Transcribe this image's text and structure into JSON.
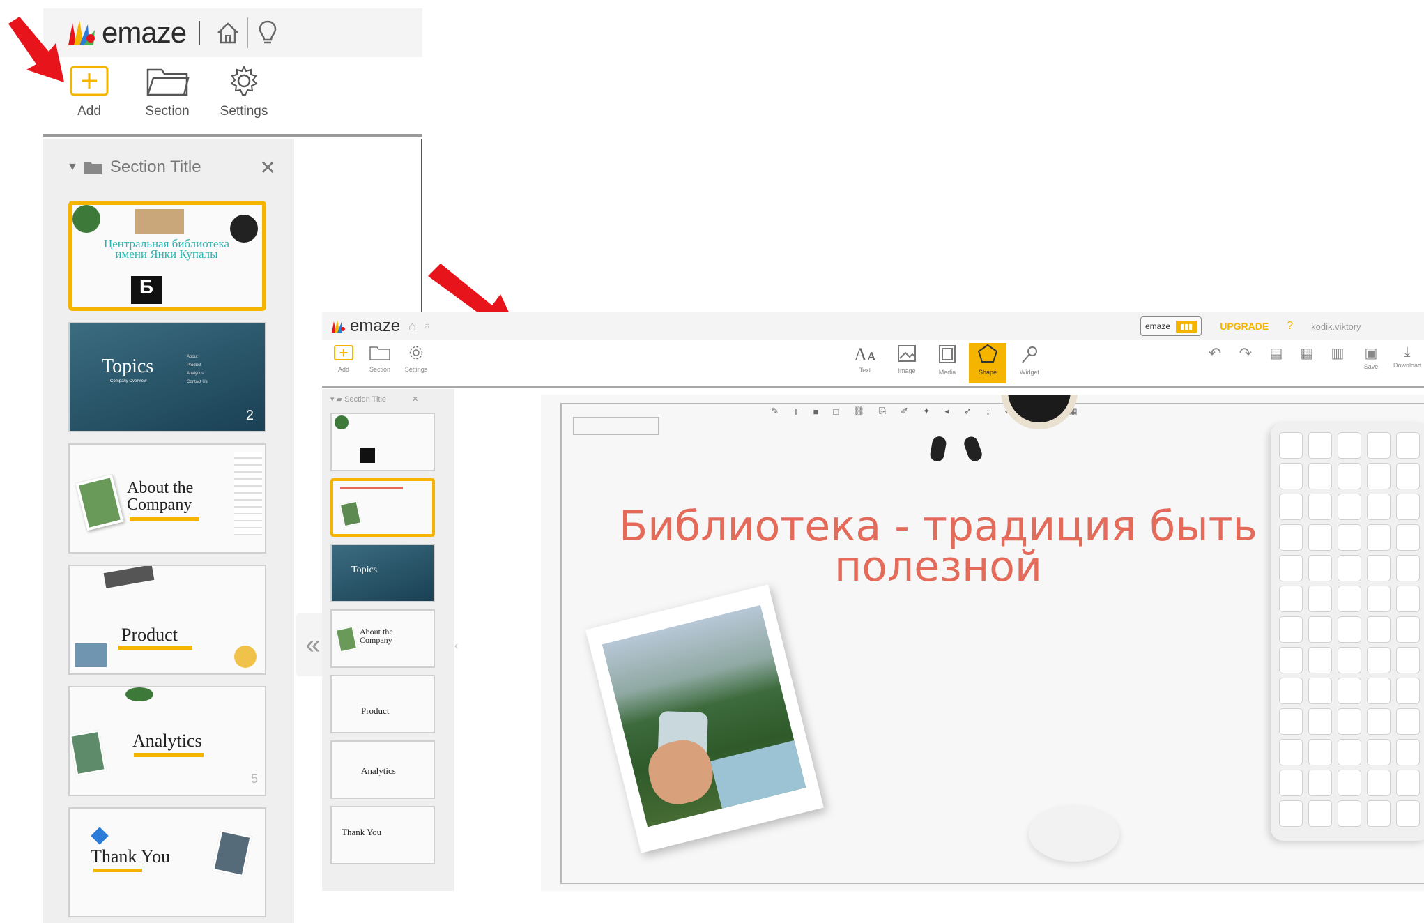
{
  "brand": {
    "name": "emaze",
    "accent": "#f5b400",
    "arrow_color": "#e8141b",
    "heading_color": "#e46a5a"
  },
  "left_toolbar": {
    "add_label": "Add",
    "section_label": "Section",
    "settings_label": "Settings"
  },
  "section": {
    "title": "Section Title"
  },
  "slides": [
    {
      "title": "Центральная библиотека имени Янки Купалы"
    },
    {
      "title": "Topics",
      "subtitle": "Company Overview",
      "items": [
        "About",
        "Product",
        "Analytics",
        "Contact Us"
      ],
      "number": "2"
    },
    {
      "title": "About the Company"
    },
    {
      "title": "Product"
    },
    {
      "title": "Analytics",
      "number": "5"
    },
    {
      "title": "Thank You"
    }
  ],
  "editor": {
    "brand": "emaze",
    "left_tools": [
      "Add",
      "Section",
      "Settings"
    ],
    "center_tools": [
      "Text",
      "Image",
      "Media",
      "Shape",
      "Widget"
    ],
    "right_tools": [
      "Undo",
      "Redo",
      "Save",
      "Download"
    ],
    "badge": "emaze",
    "upgrade": "UPGRADE",
    "help": "?",
    "user": "kodik.viktory",
    "section_title": "Section Title",
    "mini_slides": [
      "",
      "",
      "Topics",
      "About the Company",
      "Product",
      "Analytics",
      "Thank You"
    ],
    "slide_heading_line1": "Библиотека - традиция быть",
    "slide_heading_line2": "полезной"
  }
}
